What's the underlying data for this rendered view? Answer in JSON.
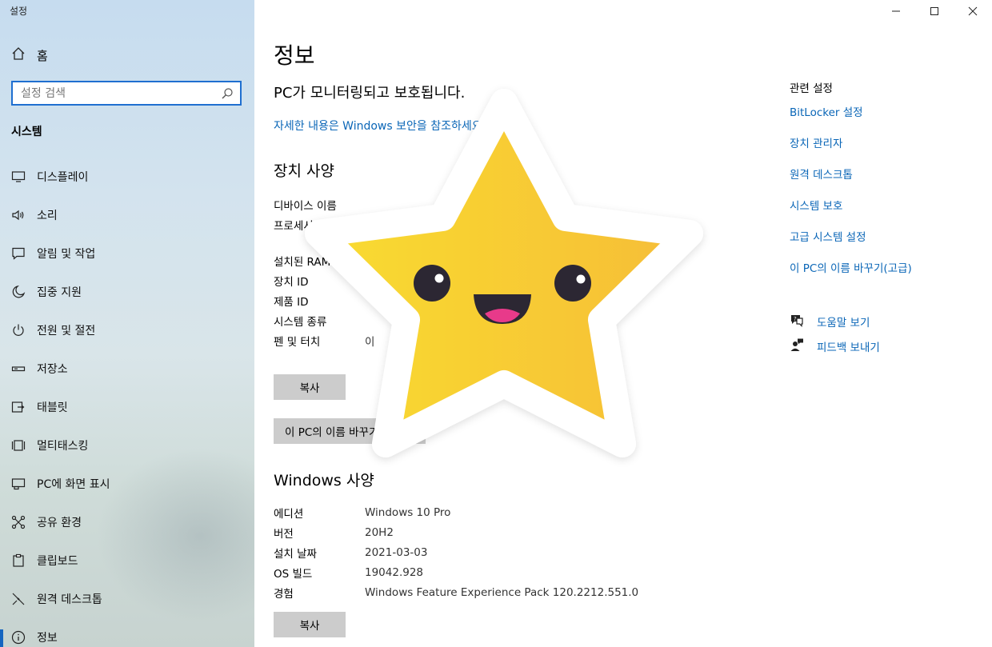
{
  "window": {
    "title": "설정"
  },
  "sidebar": {
    "home_label": "홈",
    "search_placeholder": "설정 검색",
    "section_title": "시스템",
    "items": [
      {
        "label": "디스플레이",
        "icon": "monitor-icon"
      },
      {
        "label": "소리",
        "icon": "speaker-icon"
      },
      {
        "label": "알림 및 작업",
        "icon": "message-icon"
      },
      {
        "label": "집중 지원",
        "icon": "moon-icon"
      },
      {
        "label": "전원 및 절전",
        "icon": "power-icon"
      },
      {
        "label": "저장소",
        "icon": "storage-icon"
      },
      {
        "label": "태블릿",
        "icon": "tablet-icon"
      },
      {
        "label": "멀티태스킹",
        "icon": "multitask-icon"
      },
      {
        "label": "PC에 화면 표시",
        "icon": "project-icon"
      },
      {
        "label": "공유 환경",
        "icon": "share-icon"
      },
      {
        "label": "클립보드",
        "icon": "clipboard-icon"
      },
      {
        "label": "원격 데스크톱",
        "icon": "remote-icon"
      },
      {
        "label": "정보",
        "icon": "info-icon",
        "active": true
      }
    ]
  },
  "main": {
    "page_title": "정보",
    "protect_text": "PC가 모니터링되고 보호됩니다.",
    "protect_link": "자세한 내용은 Windows 보안을 참조하세요.",
    "device_specs": {
      "title": "장치 사양",
      "rows": [
        {
          "key": "디바이스 이름",
          "value": ""
        },
        {
          "key": "프로세서",
          "value": ""
        },
        {
          "key": "설치된 RAM",
          "value": ""
        },
        {
          "key": "장치 ID",
          "value": ""
        },
        {
          "key": "제품 ID",
          "value": ""
        },
        {
          "key": "시스템 종류",
          "value": ""
        },
        {
          "key": "펜 및 터치",
          "value": "이"
        }
      ],
      "copy_button": "복사",
      "rename_button": "이 PC의 이름 바꾸기"
    },
    "windows_specs": {
      "title": "Windows 사양",
      "rows": [
        {
          "key": "에디션",
          "value": "Windows 10 Pro"
        },
        {
          "key": "버전",
          "value": "20H2"
        },
        {
          "key": "설치 날짜",
          "value": "2021-03-03"
        },
        {
          "key": "OS 빌드",
          "value": "19042.928"
        },
        {
          "key": "경험",
          "value": "Windows Feature Experience Pack 120.2212.551.0"
        }
      ],
      "copy_button": "복사"
    },
    "related": {
      "title": "관련 설정",
      "links": [
        "BitLocker 설정",
        "장치 관리자",
        "원격 데스크톱",
        "시스템 보호",
        "고급 시스템 설정",
        "이 PC의 이름 바꾸기(고급)"
      ]
    },
    "help": {
      "get_help": "도움말 보기",
      "feedback": "피드백 보내기"
    }
  },
  "overlay": {
    "icon": "star-face-icon",
    "colors": {
      "star": "#f7c830",
      "outline": "#ffffff",
      "mouth": "#e83a8a"
    }
  }
}
